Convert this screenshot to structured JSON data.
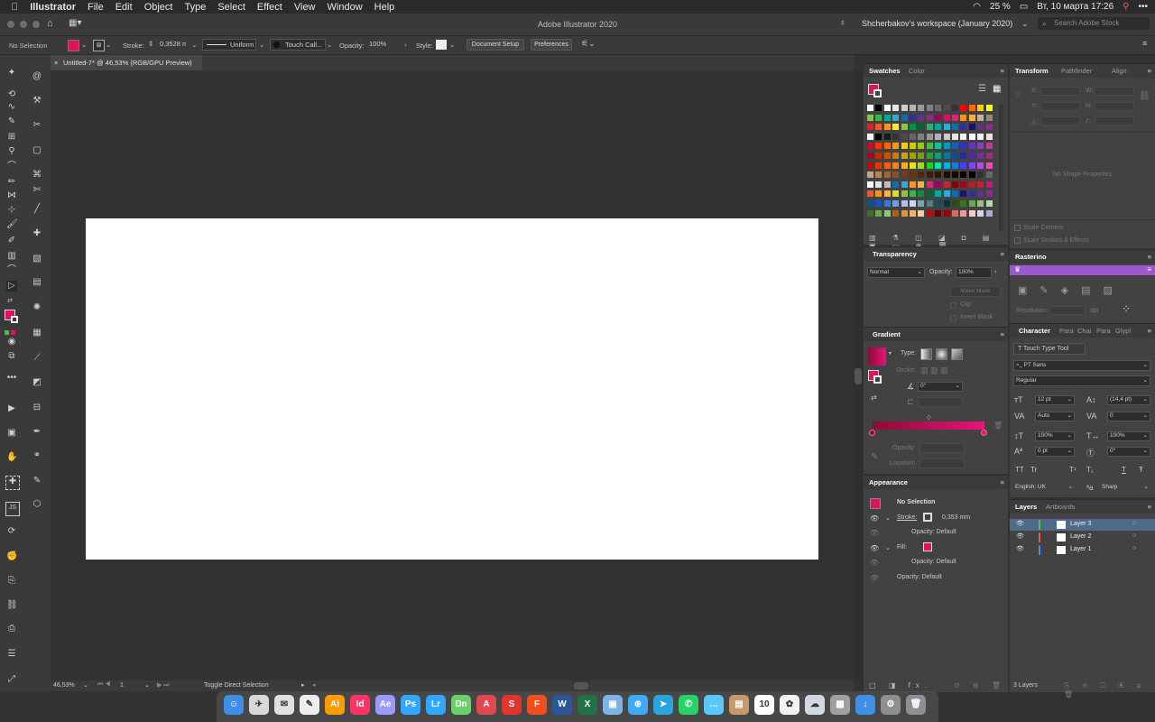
{
  "menubar": {
    "app_name": "Illustrator",
    "items": [
      "File",
      "Edit",
      "Object",
      "Type",
      "Select",
      "Effect",
      "View",
      "Window",
      "Help"
    ],
    "battery": "25 %",
    "datetime": "Вт, 10 марта  17:26"
  },
  "titlebar": {
    "title": "Adobe Illustrator 2020",
    "workspace": "Shcherbakov's workspace (January 2020)",
    "search_placeholder": "Search Adobe Stock"
  },
  "control": {
    "selection": "No Selection",
    "stroke_label": "Stroke:",
    "stroke_value": "0,3528 п",
    "profile": "Uniform",
    "brush": "Touch Call...",
    "opacity_label": "Opacity:",
    "opacity_value": "100%",
    "style_label": "Style:",
    "document_setup": "Document Setup",
    "preferences": "Preferences",
    "fill_color": "#e0115f"
  },
  "document": {
    "tab_title": "Untitled-7* @ 46,53% (RGB/GPU Preview)"
  },
  "status": {
    "zoom": "46,53%",
    "artboard": "1",
    "tool_hint": "Toggle Direct Selection"
  },
  "swatches": {
    "tabs": [
      "Swatches",
      "Color"
    ],
    "rows": [
      [
        "#ffffff",
        "#000000",
        "#ffffff",
        "#e6e6e6",
        "#cccccc",
        "#b3b3b3",
        "#999999",
        "#808080",
        "#666666",
        "#4d4d4d",
        "#333333",
        "#ff0000",
        "#ff6600",
        "#ffcc00",
        "#ffff00"
      ],
      [
        "#8cc63f",
        "#39b54a",
        "#00a99d",
        "#29abe2",
        "#0071bc",
        "#2e3192",
        "#662d91",
        "#93278f",
        "#9e005d",
        "#d4145a",
        "#ed1e79",
        "#f7931e",
        "#fbb03b",
        "#c7b299",
        "#998675"
      ],
      [
        "#ed1c24",
        "#f15a24",
        "#f7931e",
        "#fcee21",
        "#8cc63f",
        "#009245",
        "#006837",
        "#22b573",
        "#00a99d",
        "#29abe2",
        "#0071bc",
        "#2e3192",
        "#1b1464",
        "#662d91",
        "#93278f"
      ],
      [
        "#ffffff",
        "#000000",
        "#1a1a1a",
        "#333333",
        "#4d4d4d",
        "#666666",
        "#808080",
        "#999999",
        "#b3b3b3",
        "#cccccc",
        "#e6e6e6",
        "#f2f2f2",
        "#ffffff",
        "#f2f2f2",
        "#e6e6e6"
      ],
      [
        "#e1002a",
        "#ff3300",
        "#ff6600",
        "#ff9900",
        "#ffcc00",
        "#cccc00",
        "#99cc00",
        "#33cc33",
        "#00cc99",
        "#0099cc",
        "#0066cc",
        "#3333cc",
        "#6633cc",
        "#9933cc",
        "#cc3399"
      ],
      [
        "#b30021",
        "#cc2900",
        "#cc5200",
        "#cc7a00",
        "#cca300",
        "#a3a300",
        "#7aa300",
        "#29a329",
        "#00a37a",
        "#007aa3",
        "#0052a3",
        "#2929a3",
        "#5229a3",
        "#7a29a3",
        "#a3297a"
      ],
      [
        "#cc0000",
        "#e63900",
        "#ff5c00",
        "#ff8000",
        "#ffb300",
        "#e6e600",
        "#99e600",
        "#00e600",
        "#00e6b3",
        "#00b3e6",
        "#0080ff",
        "#4040ff",
        "#8040ff",
        "#c040ff",
        "#ff40c0"
      ],
      [
        "#c9a27e",
        "#b5835a",
        "#a0663a",
        "#8c4f26",
        "#783c18",
        "#66300f",
        "#53260a",
        "#3f1c06",
        "#2e1404",
        "#1f0d02",
        "#140801",
        "#0a0400",
        "#000000",
        "#333333",
        "#666666"
      ],
      [
        "#ffffff",
        "#e3e3e3",
        "#bdbdbd",
        "#0071bc",
        "#29abe2",
        "#f7931e",
        "#fbb03b",
        "#ed1e79",
        "#9e005d",
        "#c1272d",
        "#8b0000",
        "#a50021",
        "#b22222",
        "#dc143c",
        "#c71585"
      ],
      [
        "#f15a24",
        "#f7931e",
        "#fbb03b",
        "#d9e021",
        "#8cc63f",
        "#39b54a",
        "#009245",
        "#006837",
        "#00a99d",
        "#29abe2",
        "#0071bc",
        "#1b1464",
        "#2e3192",
        "#662d91",
        "#93278f"
      ],
      [
        "#0b5394",
        "#1155cc",
        "#3c78d8",
        "#6d9eeb",
        "#a4c2f4",
        "#c9daf8",
        "#76a5af",
        "#45818e",
        "#134f5c",
        "#0c343d",
        "#274e13",
        "#38761d",
        "#6aa84f",
        "#93c47d",
        "#b6d7a8"
      ],
      [
        "#38761d",
        "#6aa84f",
        "#93c47d",
        "#b45f06",
        "#e69138",
        "#f6b26b",
        "#f9cb9c",
        "#cc0000",
        "#660000",
        "#990000",
        "#e06666",
        "#ea9999",
        "#f4cccc",
        "#d9d2e9",
        "#b4a7d6"
      ]
    ]
  },
  "transform": {
    "tabs": [
      "Transform",
      "Pathfinder",
      "Align"
    ],
    "no_shape": "No Shape Properties",
    "scale_corners": "Scale Corners",
    "scale_strokes": "Scale Strokes & Effects"
  },
  "rasterino": {
    "title": "Rasterino",
    "resolution_label": "Resolution:",
    "unit": "dpi",
    "accent": "#9b59d0"
  },
  "transparency": {
    "title": "Transparency",
    "mode": "Normal",
    "opacity_label": "Opacity:",
    "opacity_value": "100%",
    "make_mask": "Make Mask",
    "clip": "Clip",
    "invert_mask": "Invert Mask"
  },
  "gradient": {
    "title": "Gradient",
    "type_label": "Type:",
    "stroke_label": "Stroke:",
    "angle": "0°",
    "opacity_label": "Opacity:",
    "location_label": "Location:",
    "start_color": "#8a0c36",
    "end_color": "#e8137a"
  },
  "character": {
    "tabs": [
      "Character",
      "Para",
      "Chai",
      "Para",
      "Glypl"
    ],
    "touch_type": "Touch Type Tool",
    "font_family": "PT Sans",
    "font_style": "Regular",
    "size": "12 pt",
    "leading": "(14,4 pt)",
    "kerning": "Auto",
    "tracking": "0",
    "vscale": "100%",
    "hscale": "100%",
    "baseline": "0 pt",
    "rotation": "0°",
    "language": "English: UK",
    "antialias": "Sharp",
    "case_buttons": [
      "TT",
      "Tr",
      "T¹",
      "T₁",
      "T",
      "Ŧ"
    ]
  },
  "appearance": {
    "title": "Appearance",
    "header": "No Selection",
    "stroke_label": "Stroke:",
    "stroke_value": "0,353 mm",
    "opacity_label": "Opacity: Default",
    "fill_label": "Fill:",
    "fill_color": "#e0115f"
  },
  "layers": {
    "tabs": [
      "Layers",
      "Artboards"
    ],
    "items": [
      {
        "name": "Layer 3",
        "color": "#4fbf4f",
        "selected": true
      },
      {
        "name": "Layer 2",
        "color": "#ff4f4f",
        "selected": false
      },
      {
        "name": "Layer 1",
        "color": "#4f7fff",
        "selected": false
      }
    ],
    "count": "3 Layers"
  },
  "dock": {
    "apps": [
      {
        "name": "Finder",
        "label": "☺",
        "color": "#3f8fe6"
      },
      {
        "name": "Launchpad",
        "label": "✈",
        "color": "#d8d8d8"
      },
      {
        "name": "Mail",
        "label": "✉",
        "color": "#e0e0e0"
      },
      {
        "name": "Note",
        "label": "✎",
        "color": "#eeeeee"
      },
      {
        "name": "Illustrator",
        "label": "Ai",
        "color": "#ff9a00"
      },
      {
        "name": "InDesign",
        "label": "Id",
        "color": "#ff3366"
      },
      {
        "name": "After Effects",
        "label": "Ae",
        "color": "#9999ff"
      },
      {
        "name": "Photoshop",
        "label": "Ps",
        "color": "#31a8ff"
      },
      {
        "name": "Lightroom",
        "label": "Lr",
        "color": "#31a8ff"
      },
      {
        "name": "Dimension",
        "label": "Dn",
        "color": "#6ad16a"
      },
      {
        "name": "Acrobat",
        "label": "A",
        "color": "#e34850"
      },
      {
        "name": "Speed",
        "label": "S",
        "color": "#e3342f"
      },
      {
        "name": "Figma",
        "label": "F",
        "color": "#f24e1e"
      },
      {
        "name": "Word",
        "label": "W",
        "color": "#2b579a"
      },
      {
        "name": "Excel",
        "label": "X",
        "color": "#217346"
      },
      {
        "name": "Preview",
        "label": "▣",
        "color": "#7fb2e5"
      },
      {
        "name": "Safari",
        "label": "⊕",
        "color": "#3fa9f5"
      },
      {
        "name": "Telegram",
        "label": "➤",
        "color": "#2aa3df"
      },
      {
        "name": "WhatsApp",
        "label": "✆",
        "color": "#25d366"
      },
      {
        "name": "Messages",
        "label": "…",
        "color": "#5ac8fa"
      },
      {
        "name": "Contacts",
        "label": "▤",
        "color": "#c49a6c"
      },
      {
        "name": "Calendar",
        "label": "10",
        "color": "#ffffff"
      },
      {
        "name": "Photos",
        "label": "✿",
        "color": "#f2f2f2"
      },
      {
        "name": "Cloud",
        "label": "☁",
        "color": "#cfd8e3"
      },
      {
        "name": "Image",
        "label": "▩",
        "color": "#a0a0a0"
      },
      {
        "name": "Downloads",
        "label": "↓",
        "color": "#3f8fe6"
      },
      {
        "name": "Settings",
        "label": "⚙",
        "color": "#8e8e93"
      },
      {
        "name": "Trash",
        "label": "🗑",
        "color": "#8e8e93"
      }
    ]
  }
}
